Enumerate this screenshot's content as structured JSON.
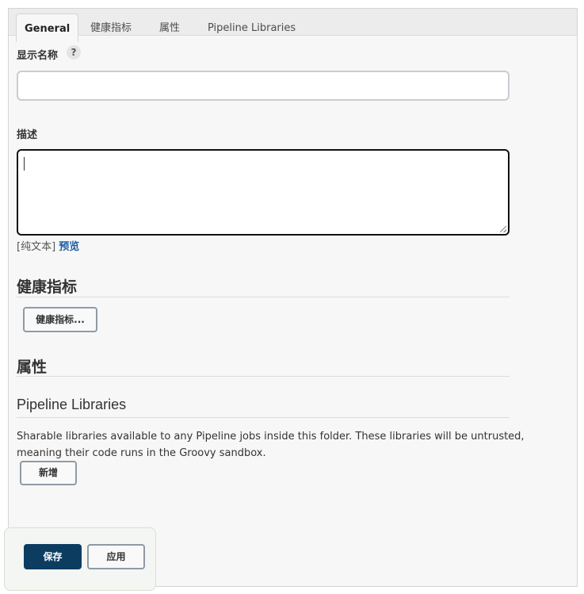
{
  "tabs": [
    {
      "label": "General",
      "active": true
    },
    {
      "label": "健康指标",
      "active": false
    },
    {
      "label": "属性",
      "active": false
    },
    {
      "label": "Pipeline Libraries",
      "active": false
    }
  ],
  "form": {
    "display_name_label": "显示名称",
    "help_glyph": "?",
    "display_name_value": "",
    "description_label": "描述",
    "description_value": "",
    "format_prefix": "[纯文本]",
    "preview_link": "预览"
  },
  "sections": {
    "health": {
      "title": "健康指标",
      "button": "健康指标..."
    },
    "properties": {
      "title": "属性"
    },
    "libraries": {
      "title": "Pipeline Libraries",
      "description": "Sharable libraries available to any Pipeline jobs inside this folder. These libraries will be untrusted, meaning their code runs in the Groovy sandbox.",
      "add_button": "新增"
    }
  },
  "footer": {
    "save": "保存",
    "apply": "应用"
  },
  "colors": {
    "primary": "#0d3c61",
    "link": "#1c5ea6",
    "panel": "#f7f7f7"
  }
}
